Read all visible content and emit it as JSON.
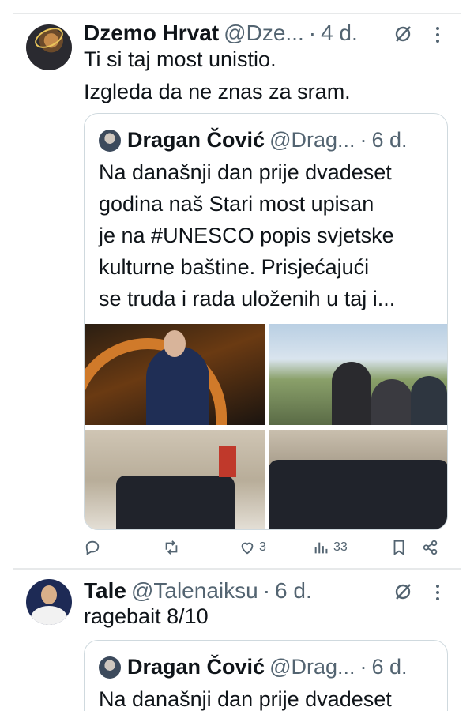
{
  "tweets": [
    {
      "name": "Dzemo Hrvat",
      "handle": "@Dze...",
      "time": "4 d.",
      "text_lines": [
        "Ti si taj most unistio.",
        "Izgleda da ne znas za sram."
      ],
      "quote": {
        "name": "Dragan Čović",
        "handle": "@Drag...",
        "time": "6 d.",
        "text_lines": [
          "Na današnji dan prije dvadeset",
          "godina naš Stari most upisan",
          "je na #UNESCO popis svjetske",
          "kulturne baštine. Prisjećajući",
          "se truda i rada uloženih u taj i..."
        ]
      },
      "actions": {
        "replies": "",
        "reposts": "",
        "likes": "3",
        "views": "33"
      }
    },
    {
      "name": "Tale",
      "handle": "@Talenaiksu",
      "time": "6 d.",
      "text_lines": [
        "ragebait 8/10"
      ],
      "quote": {
        "name": "Dragan Čović",
        "handle": "@Drag...",
        "time": "6 d.",
        "text_lines": [
          "Na današnji dan prije dvadeset"
        ]
      }
    }
  ],
  "separator_dot": "·",
  "icons": [
    "grok-icon",
    "more-options-icon",
    "reply-icon",
    "repost-icon",
    "like-icon",
    "views-icon",
    "bookmark-icon",
    "share-icon"
  ],
  "colors": {
    "text": "#0f1419",
    "secondary": "#536471",
    "border": "#cfd9de"
  }
}
